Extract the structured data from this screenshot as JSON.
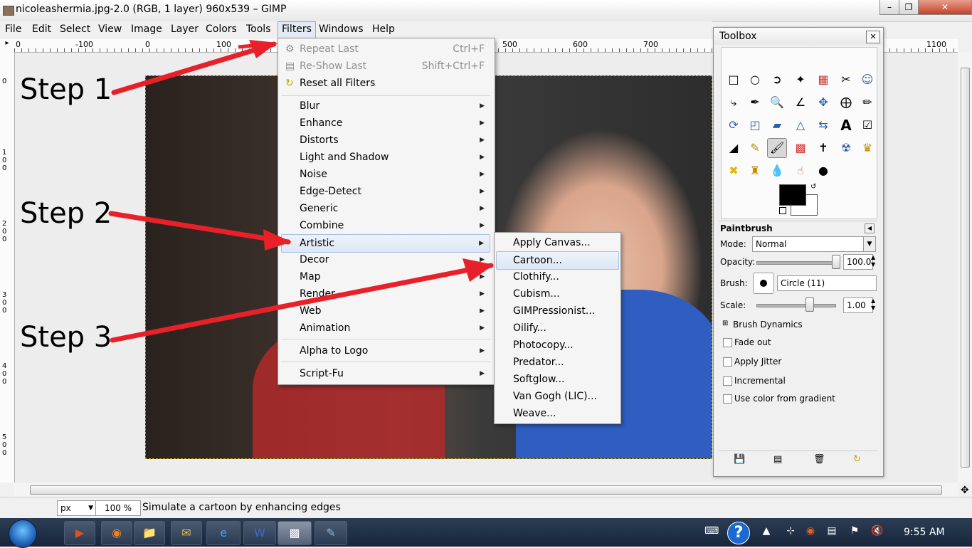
{
  "window": {
    "title": "nicoleashermia.jpg-2.0 (RGB, 1 layer) 960x539 – GIMP",
    "controls": [
      "minimize",
      "maximize",
      "close"
    ]
  },
  "menubar": [
    "File",
    "Edit",
    "Select",
    "View",
    "Image",
    "Layer",
    "Colors",
    "Tools",
    "Filters",
    "Windows",
    "Help"
  ],
  "ruler_top_ticks": [
    "0",
    "-100",
    "0",
    "100",
    "500",
    "600",
    "700",
    "1100"
  ],
  "ruler_left_ticks": [
    "0",
    "100",
    "200",
    "300",
    "400",
    "500"
  ],
  "filters_menu": {
    "top_items": [
      {
        "label": "Repeat Last",
        "shortcut": "Ctrl+F",
        "disabled": true
      },
      {
        "label": "Re-Show Last",
        "shortcut": "Shift+Ctrl+F",
        "disabled": true
      },
      {
        "label": "Reset all Filters",
        "shortcut": "",
        "disabled": false
      }
    ],
    "submenus": [
      "Blur",
      "Enhance",
      "Distorts",
      "Light and Shadow",
      "Noise",
      "Edge-Detect",
      "Generic",
      "Combine",
      "Artistic",
      "Decor",
      "Map",
      "Render",
      "Web",
      "Animation"
    ],
    "alpha_to_logo": "Alpha to Logo",
    "script_fu": "Script-Fu",
    "highlighted": "Artistic"
  },
  "artistic_menu": {
    "items": [
      "Apply Canvas...",
      "Cartoon...",
      "Clothify...",
      "Cubism...",
      "GIMPressionist...",
      "Oilify...",
      "Photocopy...",
      "Predator...",
      "Softglow...",
      "Van Gogh (LIC)...",
      "Weave..."
    ],
    "highlighted": "Cartoon..."
  },
  "annotations": {
    "step1": "Step 1",
    "step2": "Step 2",
    "step3": "Step 3",
    "arrow_color": "#e8202a"
  },
  "toolbox": {
    "title": "Toolbox",
    "tool_options_title": "Paintbrush",
    "mode_label": "Mode:",
    "mode_value": "Normal",
    "opacity_label": "Opacity:",
    "opacity_value": "100.0",
    "brush_label": "Brush:",
    "brush_value": "Circle (11)",
    "scale_label": "Scale:",
    "scale_value": "1.00",
    "brush_dynamics": "Brush Dynamics",
    "options": [
      "Fade out",
      "Apply Jitter",
      "Incremental",
      "Use color from gradient"
    ],
    "fg_color": "#000000",
    "bg_color": "#ffffff"
  },
  "statusbar": {
    "unit": "px",
    "zoom": "100 %",
    "message": "Simulate a cartoon by enhancing edges"
  },
  "taskbar": {
    "clock": "9:55 AM"
  }
}
